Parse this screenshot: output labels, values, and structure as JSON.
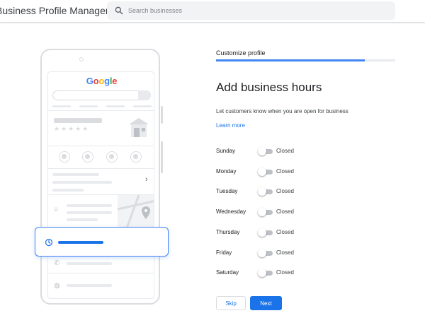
{
  "header": {
    "app_title": "Business Profile Manager",
    "search_placeholder": "Search businesses",
    "search_value": ""
  },
  "illustration": {
    "logo_letters": [
      {
        "ch": "G",
        "color": "#4285F4"
      },
      {
        "ch": "o",
        "color": "#EA4335"
      },
      {
        "ch": "o",
        "color": "#FBBC05"
      },
      {
        "ch": "g",
        "color": "#4285F4"
      },
      {
        "ch": "l",
        "color": "#34A853"
      },
      {
        "ch": "e",
        "color": "#EA4335"
      }
    ],
    "stars": "★★★★★"
  },
  "wizard": {
    "step_label": "Customize profile",
    "progress": 0.83,
    "title": "Add business hours",
    "subtitle": "Let customers know when you are open for business",
    "learn_more": "Learn more",
    "days": [
      {
        "label": "Sunday",
        "status": "Closed",
        "open": false
      },
      {
        "label": "Monday",
        "status": "Closed",
        "open": false
      },
      {
        "label": "Tuesday",
        "status": "Closed",
        "open": false
      },
      {
        "label": "Wednesday",
        "status": "Closed",
        "open": false
      },
      {
        "label": "Thursday",
        "status": "Closed",
        "open": false
      },
      {
        "label": "Friday",
        "status": "Closed",
        "open": false
      },
      {
        "label": "Saturday",
        "status": "Closed",
        "open": false
      }
    ],
    "skip_label": "Skip",
    "next_label": "Next"
  },
  "colors": {
    "accent": "#1a73e8",
    "progress": "#4285f4"
  }
}
